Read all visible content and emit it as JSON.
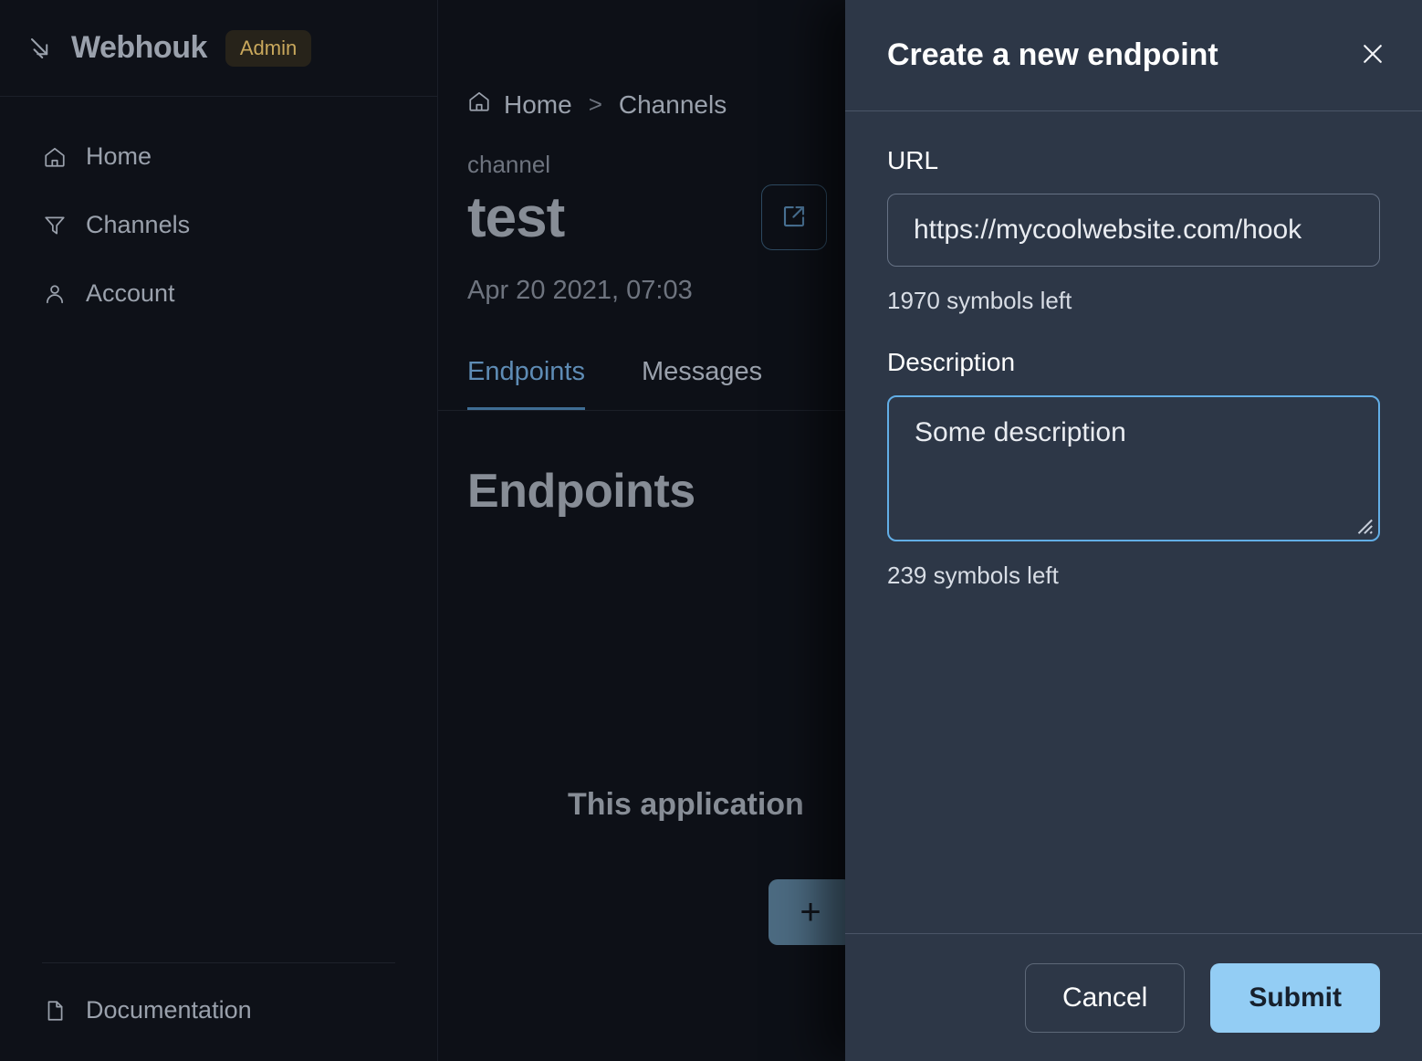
{
  "sidebar": {
    "brand": {
      "name": "Webhouk",
      "badge": "Admin",
      "icon": "arrow-hook-icon"
    },
    "items": [
      {
        "label": "Home",
        "icon": "home-icon"
      },
      {
        "label": "Channels",
        "icon": "funnel-icon"
      },
      {
        "label": "Account",
        "icon": "user-icon"
      }
    ],
    "footer": {
      "label": "Documentation",
      "icon": "file-icon"
    }
  },
  "main": {
    "breadcrumb": {
      "home": "Home",
      "separator": ">",
      "current": "Channels",
      "home_icon": "home-icon"
    },
    "entity_kind": "channel",
    "title": "test",
    "date": "Apr 20 2021, 07:03",
    "external_link_icon": "external-link-icon",
    "tabs": [
      {
        "label": "Endpoints",
        "active": true
      },
      {
        "label": "Messages",
        "active": false
      }
    ],
    "section_title": "Endpoints",
    "empty_note": "This application",
    "add_button_label": "+"
  },
  "modal": {
    "title": "Create a new endpoint",
    "close_icon": "close-icon",
    "url_field": {
      "label": "URL",
      "value": "https://mycoolwebsite.com/hook",
      "placeholder": "https://mycoolwebsite.com/hook",
      "hint": "1970 symbols left"
    },
    "description_field": {
      "label": "Description",
      "value": "Some description",
      "placeholder": "Some description",
      "hint": "239 symbols left"
    },
    "cancel_label": "Cancel",
    "submit_label": "Submit"
  },
  "colors": {
    "sidebar_bg": "#0E1118",
    "main_bg": "#0D1017",
    "modal_bg": "#2D3747",
    "accent_blue": "#93CDF4",
    "focus_blue": "#62AEE6",
    "tab_active": "#5E8CB5",
    "badge_text": "#C9A85C",
    "badge_bg": "#27231A",
    "fab_bg": "#4C6B82"
  }
}
